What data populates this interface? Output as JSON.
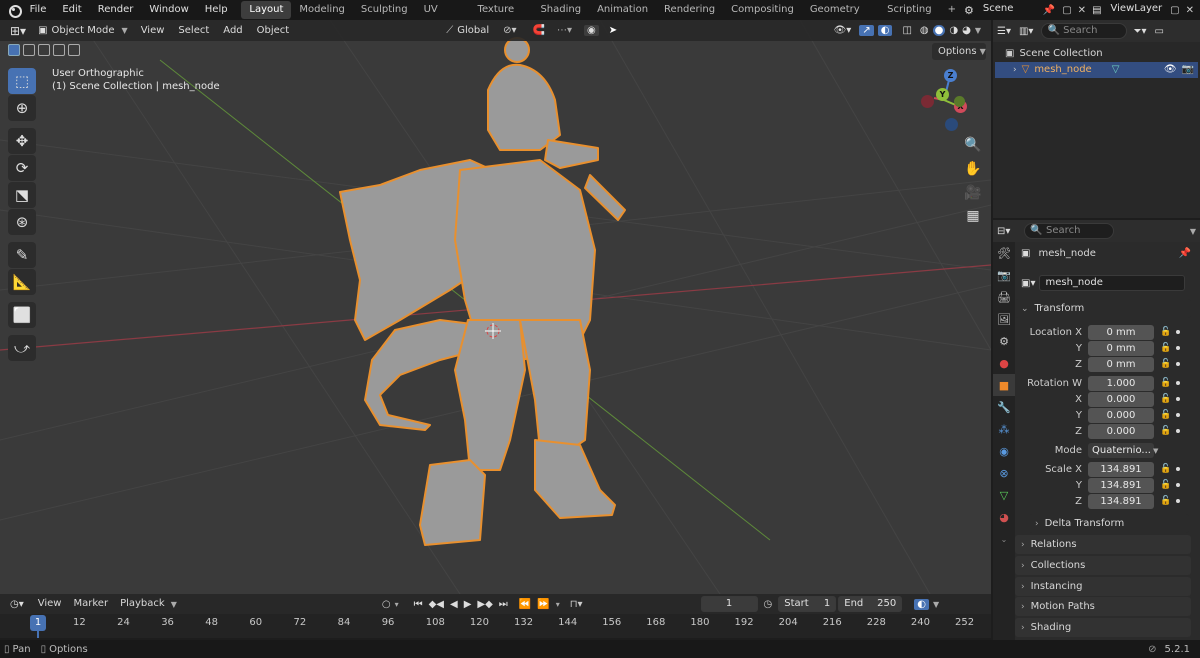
{
  "topbar": {
    "menus": [
      "File",
      "Edit",
      "Render",
      "Window",
      "Help"
    ],
    "workspaces": [
      "Layout",
      "Modeling",
      "Sculpting",
      "UV Editing",
      "Texture Paint",
      "Shading",
      "Animation",
      "Rendering",
      "Compositing",
      "Geometry Nodes",
      "Scripting"
    ],
    "active_workspace": "Layout",
    "add_tab": "+",
    "scene": "Scene",
    "view_layer": "ViewLayer"
  },
  "viewport": {
    "mode": "Object Mode",
    "menus": [
      "View",
      "Select",
      "Add",
      "Object"
    ],
    "transform_orientation": "Global",
    "options": "Options",
    "view_name": "User Orthographic",
    "collection_info": "(1) Scene Collection | mesh_node",
    "gizmo": {
      "x": "X",
      "y": "Y",
      "z": "Z"
    }
  },
  "outliner": {
    "search_placeholder": "Search",
    "scene_collection": "Scene Collection",
    "object": "mesh_node"
  },
  "properties": {
    "search_placeholder": "Search",
    "object_name": "mesh_node",
    "name_field": "mesh_node",
    "transform_label": "Transform",
    "location": {
      "label": "Location X",
      "x": "0 mm",
      "y": "0 mm",
      "z": "0 mm"
    },
    "rotation": {
      "label": "Rotation W",
      "w": "1.000",
      "x": "0.000",
      "y": "0.000",
      "z": "0.000"
    },
    "mode_label": "Mode",
    "mode_value": "Quaternio...",
    "scale": {
      "label": "Scale X",
      "x": "134.891",
      "y": "134.891",
      "z": "134.891"
    },
    "axis_labels": {
      "x": "X",
      "y": "Y",
      "z": "Z"
    },
    "panels": [
      "Delta Transform",
      "Relations",
      "Collections",
      "Instancing",
      "Motion Paths",
      "Shading"
    ]
  },
  "timeline": {
    "menus": [
      "View",
      "Marker",
      "Playback"
    ],
    "current_frame": "1",
    "start_label": "Start",
    "start": "1",
    "end_label": "End",
    "end": "250",
    "ticks": [
      "12",
      "24",
      "36",
      "48",
      "60",
      "72",
      "84",
      "96",
      "108",
      "120",
      "132",
      "144",
      "156",
      "168",
      "180",
      "192",
      "204",
      "216",
      "228",
      "240",
      "252"
    ]
  },
  "statusbar": {
    "pan": "Pan",
    "options": "Options",
    "version": "5.2.1"
  }
}
